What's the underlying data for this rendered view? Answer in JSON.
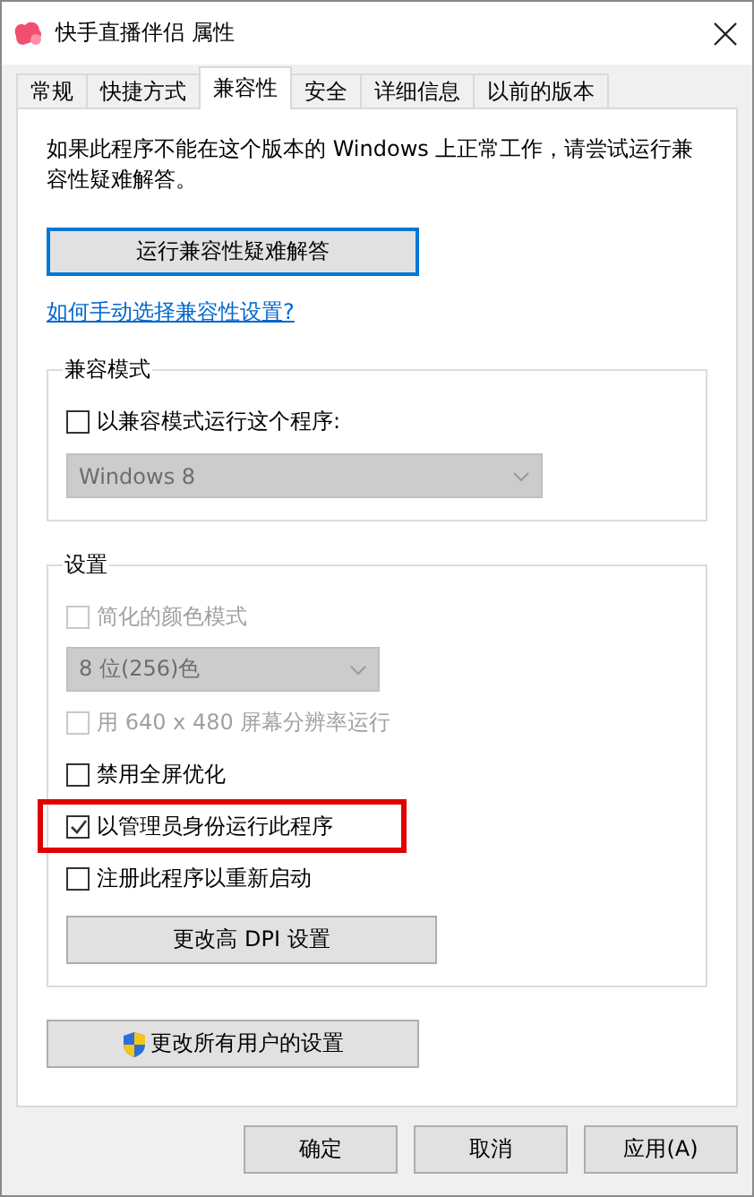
{
  "window": {
    "title": "快手直播伴侣 属性"
  },
  "tabs": [
    {
      "label": "常规",
      "selected": false
    },
    {
      "label": "快捷方式",
      "selected": false
    },
    {
      "label": "兼容性",
      "selected": true
    },
    {
      "label": "安全",
      "selected": false
    },
    {
      "label": "详细信息",
      "selected": false
    },
    {
      "label": "以前的版本",
      "selected": false
    }
  ],
  "description": "如果此程序不能在这个版本的 Windows 上正常工作，请尝试运行兼容性疑难解答。",
  "troubleshoot_button": "运行兼容性疑难解答",
  "help_link": "如何手动选择兼容性设置?",
  "compat_group": {
    "title": "兼容模式",
    "items": [
      {
        "kind": "checkbox",
        "label": "以兼容模式运行这个程序:",
        "checked": false,
        "disabled": false,
        "highlighted": false
      },
      {
        "kind": "select",
        "value": "Windows 8",
        "disabled": true
      }
    ]
  },
  "settings_group": {
    "title": "设置",
    "items": [
      {
        "kind": "checkbox",
        "label": "简化的颜色模式",
        "checked": false,
        "disabled": true,
        "highlighted": false
      },
      {
        "kind": "select",
        "value": "8 位(256)色",
        "disabled": true
      },
      {
        "kind": "checkbox",
        "label": "用 640 x 480 屏幕分辨率运行",
        "checked": false,
        "disabled": true,
        "highlighted": false
      },
      {
        "kind": "checkbox",
        "label": "禁用全屏优化",
        "checked": false,
        "disabled": false,
        "highlighted": false
      },
      {
        "kind": "checkbox",
        "label": "以管理员身份运行此程序",
        "checked": true,
        "disabled": false,
        "highlighted": true
      },
      {
        "kind": "checkbox",
        "label": "注册此程序以重新启动",
        "checked": false,
        "disabled": false,
        "highlighted": false
      },
      {
        "kind": "button",
        "label": "更改高 DPI 设置"
      }
    ]
  },
  "all_users_button": "更改所有用户的设置",
  "buttons": [
    "确定",
    "取消",
    "应用(A)"
  ]
}
